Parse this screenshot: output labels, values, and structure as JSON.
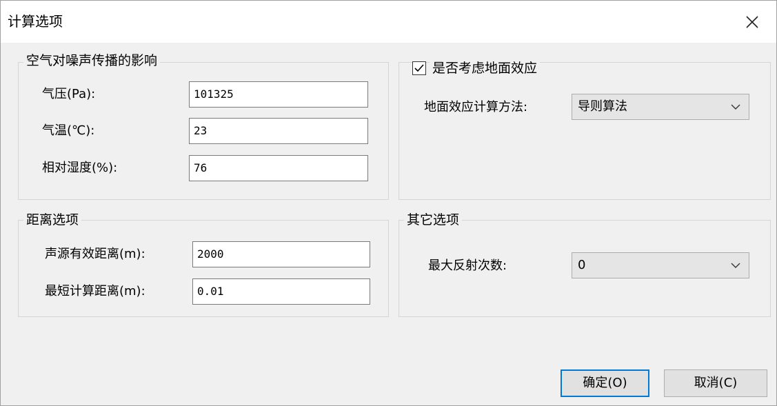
{
  "window": {
    "title": "计算选项"
  },
  "air": {
    "title": "空气对噪声传播的影响",
    "pressure_label": "气压(Pa):",
    "pressure_value": "101325",
    "temp_label": "气温(℃):",
    "temp_value": "23",
    "humidity_label": "相对湿度(%):",
    "humidity_value": "76"
  },
  "ground": {
    "checkbox_label": "是否考虑地面效应",
    "checked": true,
    "method_label": "地面效应计算方法:",
    "method_value": "导则算法"
  },
  "distance": {
    "title": "距离选项",
    "effective_label": "声源有效距离(m):",
    "effective_value": "2000",
    "min_label": "最短计算距离(m):",
    "min_value": "0.01"
  },
  "other": {
    "title": "其它选项",
    "reflection_label": "最大反射次数:",
    "reflection_value": "0"
  },
  "buttons": {
    "ok": "确定(O)",
    "cancel": "取消(C)"
  },
  "icons": {
    "close": "close-icon",
    "dropdown": "chevron-down-icon",
    "check": "check-icon"
  }
}
